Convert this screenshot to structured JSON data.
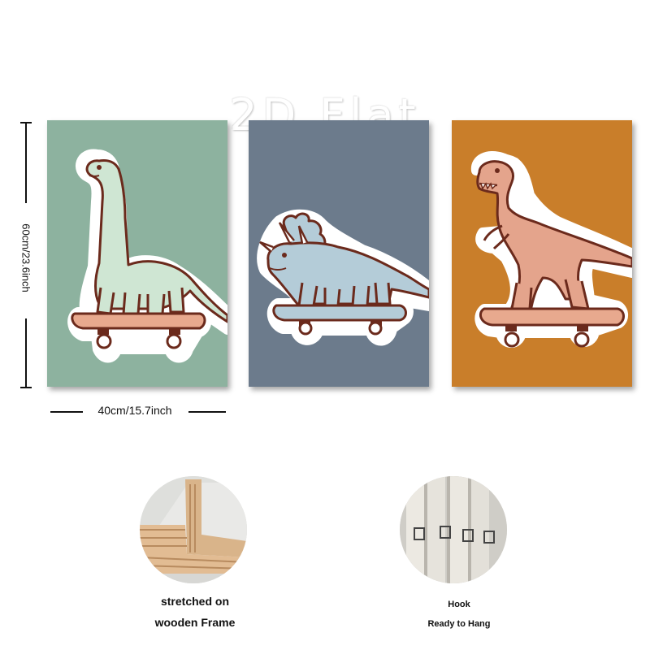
{
  "watermark": "2D Flat",
  "dimensions": {
    "height_label": "60cm/23.6inch",
    "width_label": "40cm/15.7inch"
  },
  "panels": [
    {
      "subject": "brachiosaurus on skateboard",
      "background": "#8db29f",
      "dino_color": "#cfe6d3"
    },
    {
      "subject": "triceratops on skateboard",
      "background": "#6c7b8c",
      "dino_color": "#b4ccd8"
    },
    {
      "subject": "t-rex on skateboard",
      "background": "#c97e2a",
      "dino_color": "#e4a48c"
    }
  ],
  "details": {
    "frame_caption_line1": "stretched on",
    "frame_caption_line2": "wooden Frame",
    "hook_caption_line1": "Hook",
    "hook_caption_line2": "Ready to Hang"
  },
  "colors": {
    "outline": "#6b2a1c",
    "skateboard": "#e8a98e",
    "sticker_border": "#ffffff"
  }
}
